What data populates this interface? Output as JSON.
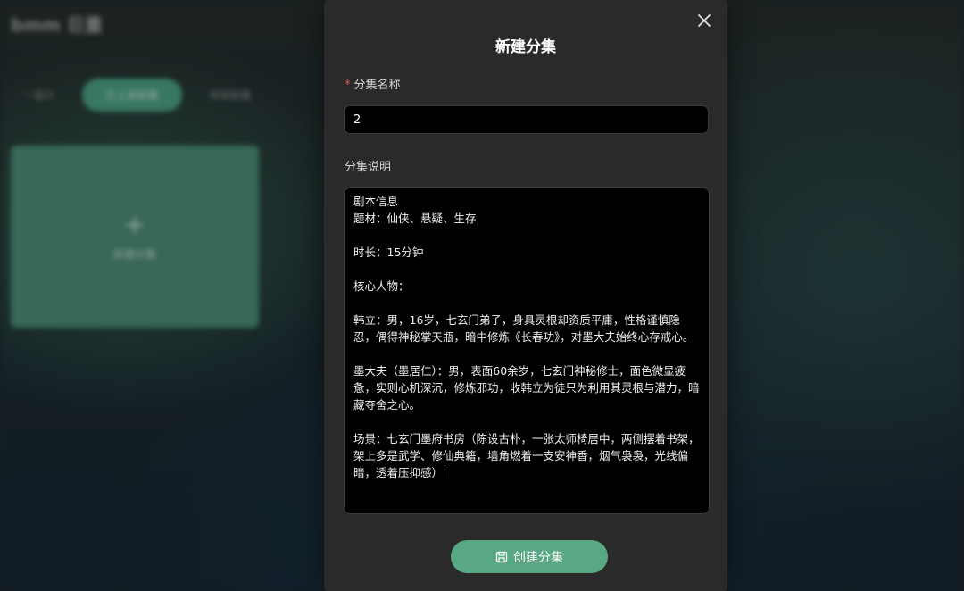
{
  "background": {
    "logo": "bmm 巨量",
    "tabs": [
      "一级片",
      "已上架剧集",
      "待审剧集"
    ],
    "card_label": "新建分集"
  },
  "modal": {
    "title": "新建分集",
    "close_icon": "close-icon",
    "name_label": "分集名称",
    "required_mark": "*",
    "name_value": "2",
    "desc_label": "分集说明",
    "desc_value": "剧本信息\n题材：仙侠、悬疑、生存\n\n时长：15分钟\n\n核心人物：\n\n韩立：男，16岁，七玄门弟子，身具灵根却资质平庸，性格谨慎隐忍，偶得神秘掌天瓶，暗中修炼《长春功》，对墨大夫始终心存戒心。\n\n墨大夫（墨居仁）：男，表面60余岁，七玄门神秘修士，面色微显疲惫，实则心机深沉，修炼邪功，收韩立为徒只为利用其灵根与潜力，暗藏夺舍之心。\n\n场景：七玄门墨府书房（陈设古朴，一张太师椅居中，两侧摆着书架，架上多是武学、修仙典籍，墙角燃着一支安神香，烟气袅袅，光线偏暗，透着压抑感）",
    "submit_label": "创建分集",
    "submit_icon": "save-icon"
  },
  "colors": {
    "accent": "#58a983",
    "modal_bg": "#2a2a2a",
    "required": "#e05a4f"
  }
}
